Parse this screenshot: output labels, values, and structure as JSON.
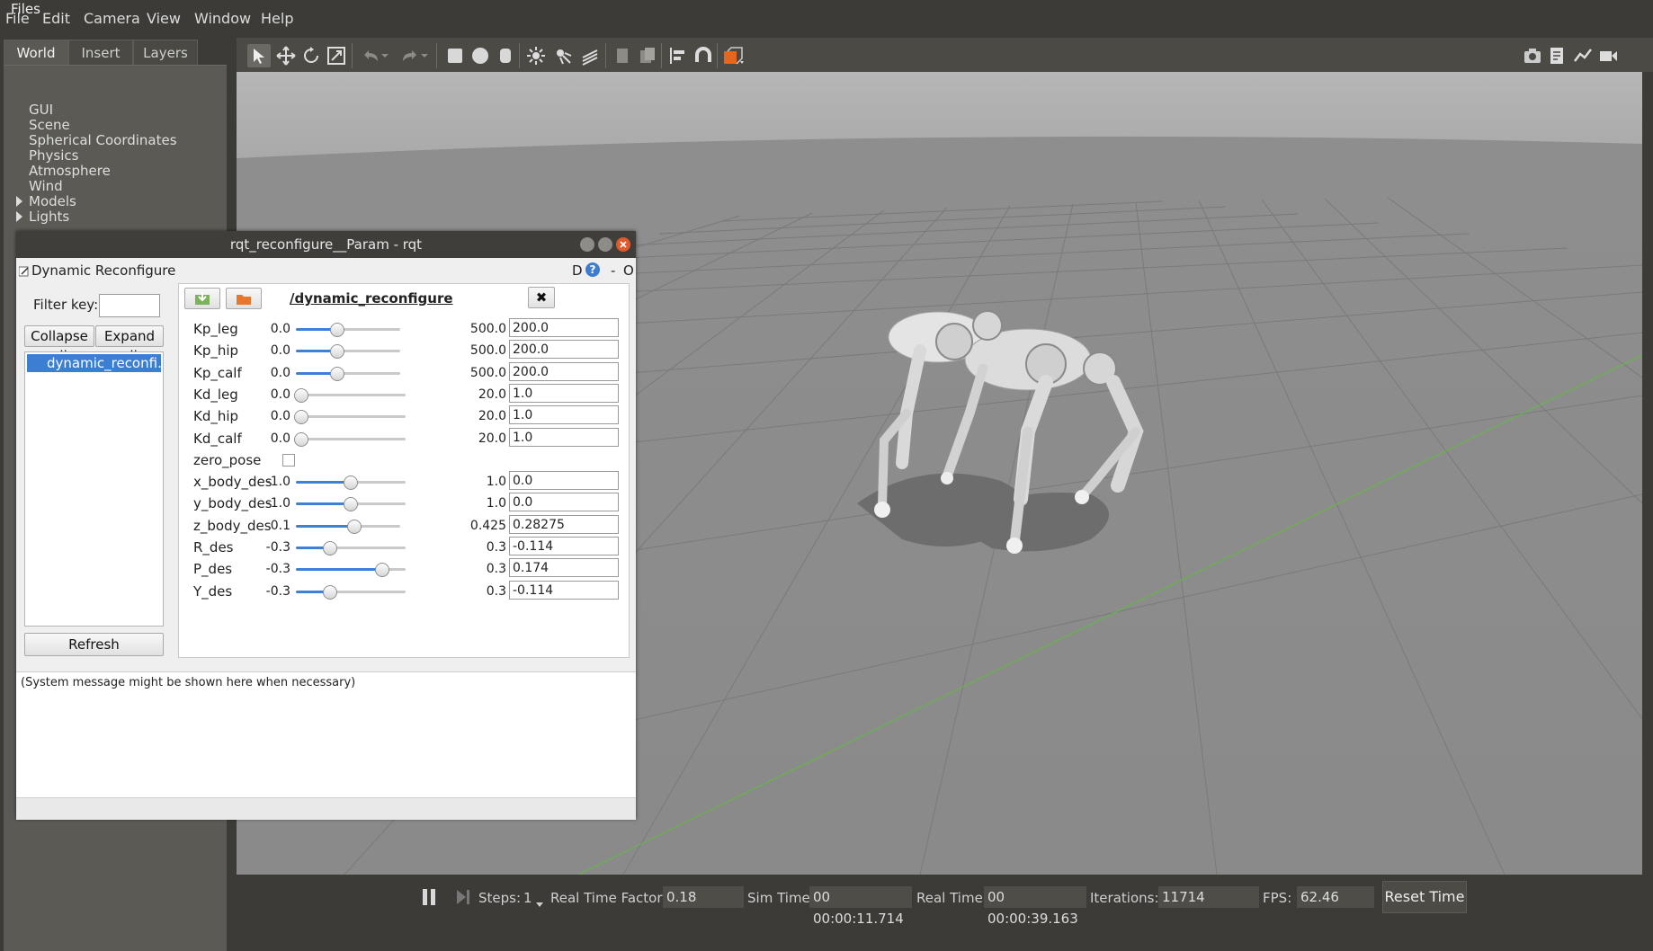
{
  "menubar": {
    "files_label": "Files",
    "items": [
      "File",
      "Edit",
      "Camera",
      "View",
      "Window",
      "Help"
    ]
  },
  "left_panel": {
    "tabs": [
      "World",
      "Insert",
      "Layers"
    ],
    "tree": [
      "GUI",
      "Scene",
      "Spherical Coordinates",
      "Physics",
      "Atmosphere",
      "Wind",
      "Models",
      "Lights"
    ]
  },
  "toolbar": {
    "icons": [
      "select-arrow-icon",
      "translate-icon",
      "rotate-icon",
      "scale-icon",
      "undo-icon",
      "redo-icon",
      "box-icon",
      "sphere-icon",
      "cylinder-icon",
      "point-light-icon",
      "spot-light-icon",
      "directional-light-icon",
      "copy-icon",
      "paste-icon",
      "align-icon",
      "snap-icon",
      "view-angle-icon",
      "screenshot-icon",
      "log-icon",
      "plot-icon",
      "record-icon"
    ]
  },
  "rqt": {
    "window_title": "rqt_reconfigure__Param - rqt",
    "plugin_title": "Dynamic Reconfigure",
    "plugin_controls": "D",
    "plugin_dash": "-",
    "plugin_o": "O",
    "filter_label": "Filter key:",
    "filter_value": "",
    "collapse_label": "Collapse all",
    "expand_label": "Expand all",
    "node_item": "dynamic_reconfi...",
    "refresh_label": "Refresh",
    "section_title": "/dynamic_reconfigure",
    "params": [
      {
        "name": "Kp_leg",
        "min": "0.0",
        "max": "500.0",
        "value": "200.0",
        "fraction": 0.4
      },
      {
        "name": "Kp_hip",
        "min": "0.0",
        "max": "500.0",
        "value": "200.0",
        "fraction": 0.4
      },
      {
        "name": "Kp_calf",
        "min": "0.0",
        "max": "500.0",
        "value": "200.0",
        "fraction": 0.4
      },
      {
        "name": "Kd_leg",
        "min": "0.0",
        "max": "20.0",
        "value": "1.0",
        "fraction": 0.05
      },
      {
        "name": "Kd_hip",
        "min": "0.0",
        "max": "20.0",
        "value": "1.0",
        "fraction": 0.05
      },
      {
        "name": "Kd_calf",
        "min": "0.0",
        "max": "20.0",
        "value": "1.0",
        "fraction": 0.05
      },
      {
        "name": "zero_pose",
        "checkbox": true,
        "checked": false
      },
      {
        "name": "x_body_des",
        "min": "-1.0",
        "max": "1.0",
        "value": "0.0",
        "fraction": 0.5
      },
      {
        "name": "y_body_des",
        "min": "-1.0",
        "max": "1.0",
        "value": "0.0",
        "fraction": 0.5
      },
      {
        "name": "z_body_des",
        "min": "0.1",
        "max": "0.425",
        "value": "0.28275",
        "fraction": 0.562
      },
      {
        "name": "R_des",
        "min": "-0.3",
        "max": "0.3",
        "value": "-0.114",
        "fraction": 0.31
      },
      {
        "name": "P_des",
        "min": "-0.3",
        "max": "0.3",
        "value": "0.174",
        "fraction": 0.79
      },
      {
        "name": "Y_des",
        "min": "-0.3",
        "max": "0.3",
        "value": "-0.114",
        "fraction": 0.31
      }
    ],
    "system_message": "(System message might be shown here when necessary)"
  },
  "bottombar": {
    "steps_label": "Steps:",
    "steps_value": "1",
    "rtf_label": "Real Time Factor:",
    "rtf_value": "0.18",
    "sim_label": "Sim Time:",
    "sim_value": "00 00:00:11.714",
    "real_label": "Real Time:",
    "real_value": "00 00:00:39.163",
    "iter_label": "Iterations:",
    "iter_value": "11714",
    "fps_label": "FPS:",
    "fps_value": "62.46",
    "reset_label": "Reset Time"
  },
  "colors": {
    "accent": "#3a7fd1",
    "grid_axis": "#5fbf3a",
    "close_button": "#e05a2b"
  }
}
